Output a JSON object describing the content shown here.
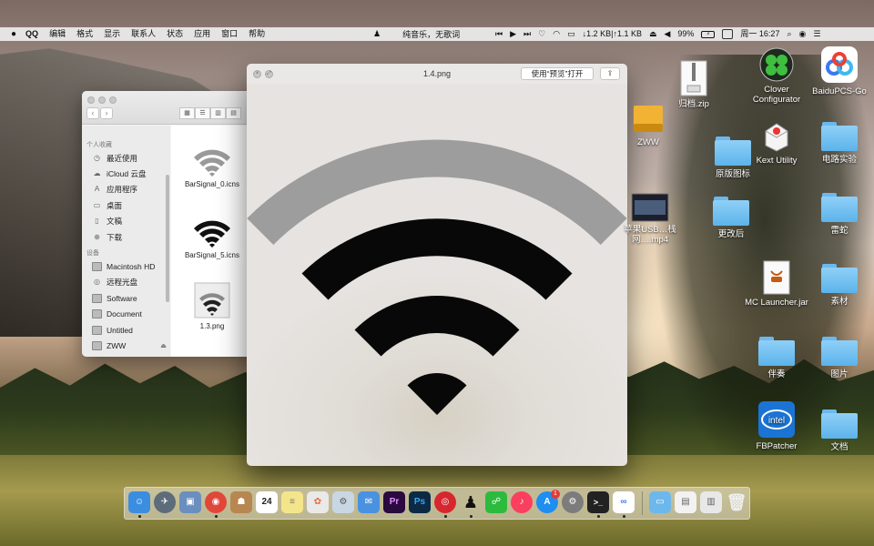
{
  "menubar": {
    "app_name": "QQ",
    "menus": [
      "编辑",
      "格式",
      "显示",
      "联系人",
      "状态",
      "应用",
      "窗口",
      "帮助"
    ],
    "now_playing": "纯音乐，无歌词",
    "network_speed": "↓1.2 KB|↑1.1 KB",
    "battery_percent": "99%",
    "clock": "周一 16:27"
  },
  "finder": {
    "sidebar": {
      "favorites_header": "个人收藏",
      "favorites": [
        {
          "label": "最近使用",
          "icon": "clock-icon"
        },
        {
          "label": "iCloud 云盘",
          "icon": "cloud-icon"
        },
        {
          "label": "应用程序",
          "icon": "apps-icon"
        },
        {
          "label": "桌面",
          "icon": "desktop-icon"
        },
        {
          "label": "文稿",
          "icon": "document-icon"
        },
        {
          "label": "下载",
          "icon": "download-icon"
        }
      ],
      "devices_header": "设备",
      "devices": [
        {
          "label": "Macintosh HD",
          "icon": "disk-icon"
        },
        {
          "label": "远程光盘",
          "icon": "optical-disc-icon"
        },
        {
          "label": "Software",
          "icon": "disk-icon"
        },
        {
          "label": "Document",
          "icon": "disk-icon"
        },
        {
          "label": "Untitled",
          "icon": "disk-icon"
        },
        {
          "label": "ZWW",
          "icon": "disk-icon"
        }
      ]
    },
    "files": [
      {
        "name": "BarSignal_0.icns"
      },
      {
        "name": "BarSignal_5.icns"
      },
      {
        "name": "1.3.png"
      }
    ]
  },
  "preview": {
    "title": "1.4.png",
    "open_button": "使用“预览”打开",
    "share_icon": "share-icon"
  },
  "desktop": {
    "icons": [
      {
        "label": "归档.zip",
        "kind": "zip"
      },
      {
        "label": "Clover Configurator",
        "kind": "app"
      },
      {
        "label": "BaiduPCS-Go",
        "kind": "app"
      },
      {
        "label": "ZWW",
        "kind": "drive"
      },
      {
        "label": "原版图标",
        "kind": "folder"
      },
      {
        "label": "Kext Utility",
        "kind": "app"
      },
      {
        "label": "电路实验",
        "kind": "folder"
      },
      {
        "label": "苹果USB…栈网….mp4",
        "kind": "video"
      },
      {
        "label": "更改后",
        "kind": "folder"
      },
      {
        "label": "雷蛇",
        "kind": "folder"
      },
      {
        "label": "MC Launcher.jar",
        "kind": "jar"
      },
      {
        "label": "素材",
        "kind": "folder"
      },
      {
        "label": "伴奏",
        "kind": "folder"
      },
      {
        "label": "图片",
        "kind": "folder"
      },
      {
        "label": "FBPatcher",
        "kind": "app"
      },
      {
        "label": "文档",
        "kind": "folder"
      }
    ]
  },
  "dock": {
    "calendar_day": "24",
    "appstore_badge": "1",
    "colors": {
      "finder": "#3b8de0",
      "launchpad": "#5d6c7a",
      "preview": "#6a8fbf",
      "chrome": "#e0473a",
      "contacts": "#b8874f",
      "calendar": "#ffffff",
      "notes": "#f4e58a",
      "photos": "#e9e9e9",
      "utility": "#c9d6e3",
      "mail": "#4a92e0",
      "premiere": "#2a0a3f",
      "photoshop": "#0c2a44",
      "netease": "#d8262f",
      "qq": "#1d1d1d",
      "wechat": "#2dbb3e",
      "music": "#fb3f5e",
      "appstore": "#1e8ef0",
      "prefs": "#7c7c7c",
      "terminal": "#222222",
      "baidu": "#3c78f0"
    }
  }
}
